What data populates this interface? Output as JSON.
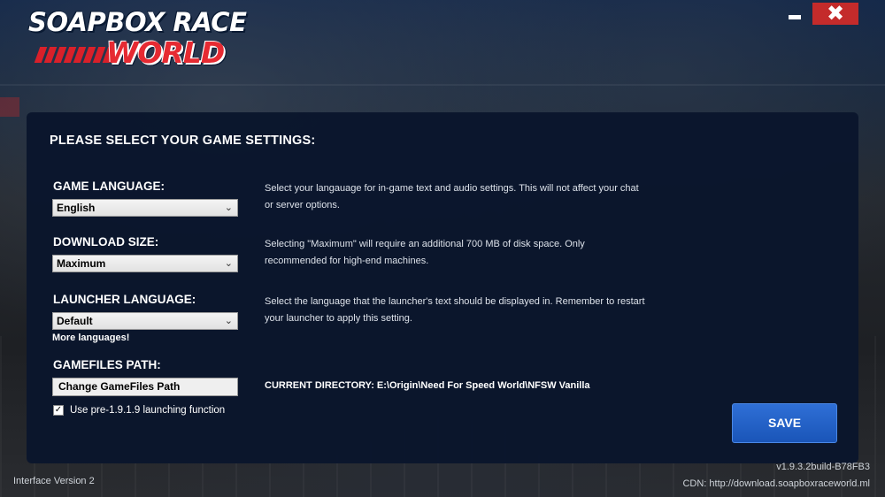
{
  "app": {
    "logo_line1": "SOAPBOX RACE",
    "logo_line2": "WORLD"
  },
  "window_controls": {
    "minimize_icon": "minimize-icon",
    "close_symbol": "✖",
    "close_color": "#c42b2b"
  },
  "panel": {
    "title": "PLEASE SELECT YOUR GAME SETTINGS:"
  },
  "settings": {
    "game_language": {
      "label": "GAME LANGUAGE:",
      "value": "English",
      "description": "Select your langauage for in-game text and audio settings. This will not affect your chat or server options."
    },
    "download_size": {
      "label": "DOWNLOAD SIZE:",
      "value": "Maximum",
      "description": "Selecting \"Maximum\" will require an additional 700 MB of disk space. Only recommended for high-end machines."
    },
    "launcher_language": {
      "label": "LAUNCHER LANGUAGE:",
      "value": "Default",
      "description": "Select the language that the launcher's text should be displayed in. Remember to restart your launcher to apply this setting.",
      "more_link": "More languages!"
    },
    "gamefiles_path": {
      "label": "GAMEFILES PATH:",
      "button_label": "Change GameFiles Path",
      "current_directory": "CURRENT DIRECTORY: E:\\Origin\\Need For Speed World\\NFSW Vanilla"
    },
    "launch_option": {
      "label": "Use pre-1.9.1.9 launching function",
      "checked": true
    }
  },
  "actions": {
    "save_label": "SAVE",
    "save_color": "#1f5fc7"
  },
  "footer": {
    "interface_version": "Interface Version 2",
    "build": "v1.9.3.2build-B78FB3",
    "cdn": "CDN: http://download.soapboxraceworld.ml"
  }
}
